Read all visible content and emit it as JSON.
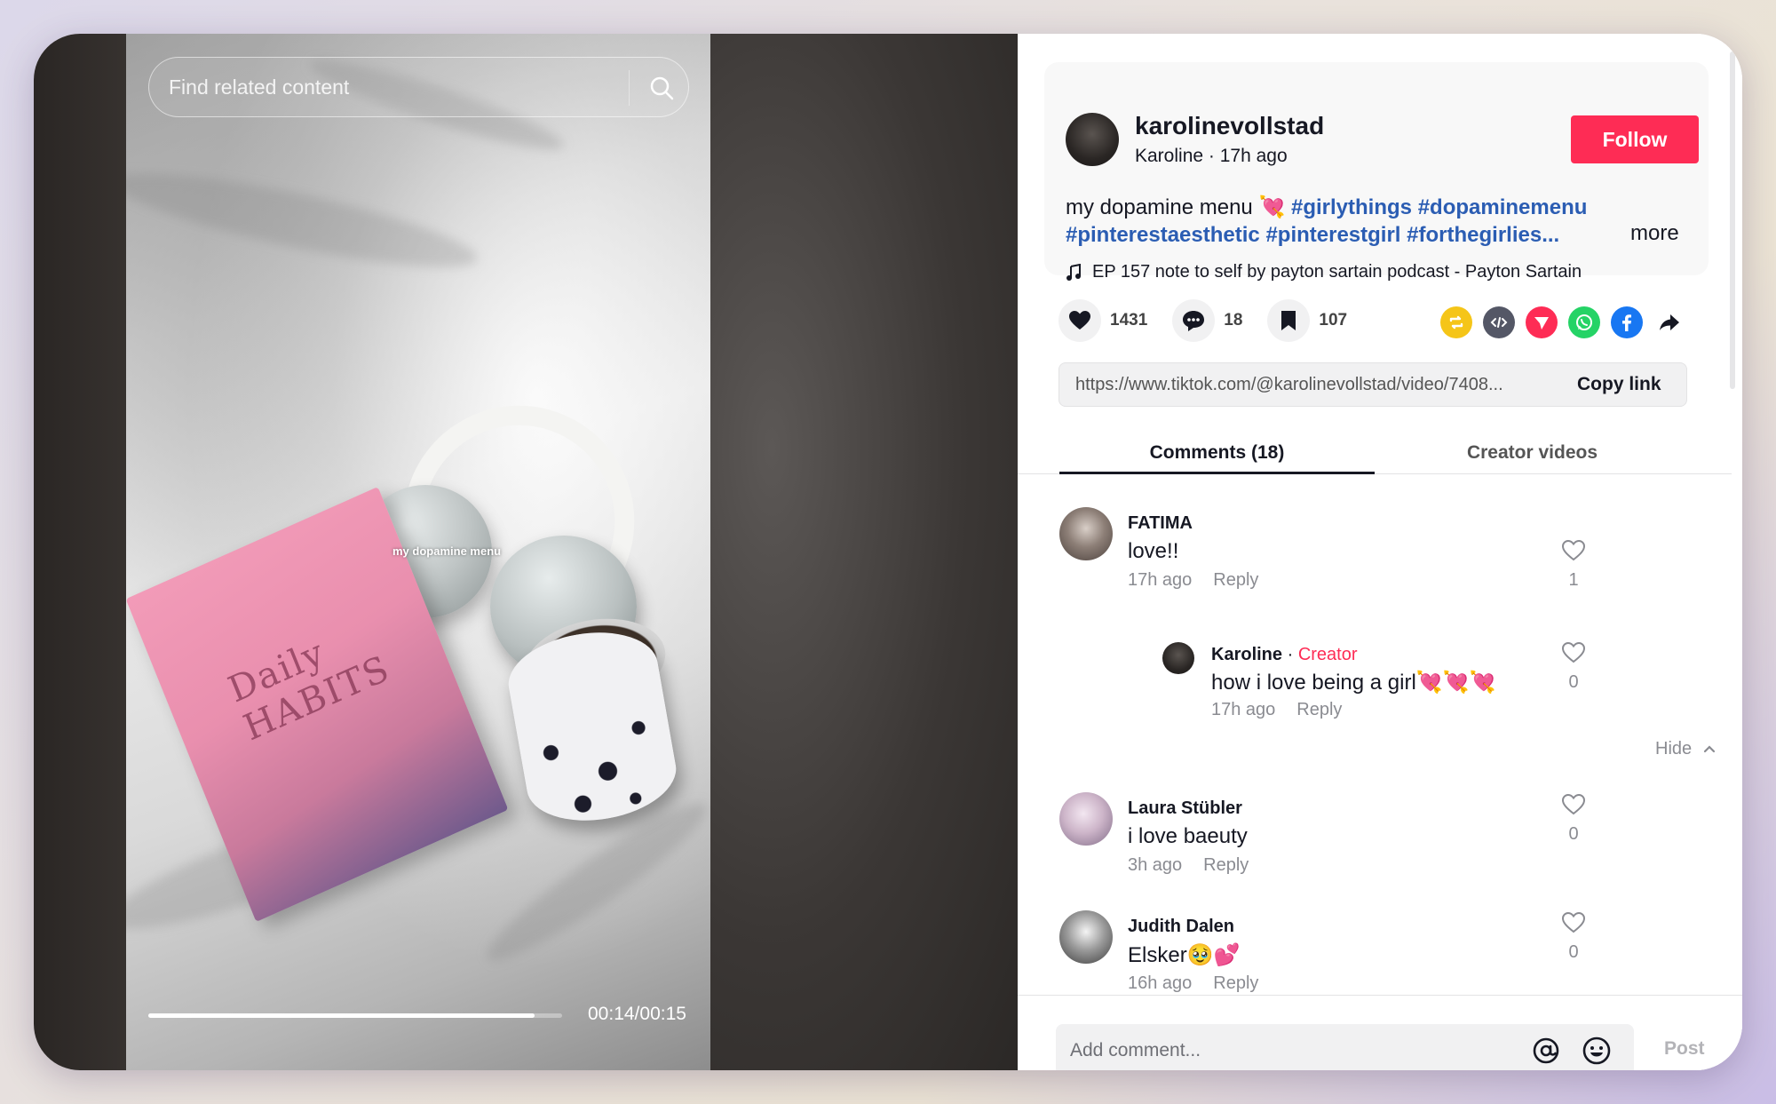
{
  "search": {
    "placeholder": "Find related content"
  },
  "video": {
    "overlay_text": "my dopamine menu",
    "book_title": "Daily HABITS",
    "current_time": "00:14/00:15",
    "progress": 0.933
  },
  "author": {
    "username": "karolinevollstad",
    "display_name": "Karoline",
    "posted": "17h ago",
    "meta_sep": " · ",
    "follow_label": "Follow"
  },
  "post": {
    "caption_text": "my dopamine menu 💘 ",
    "tags": [
      "#girlythings",
      "#dopaminemenu",
      "#pinterestaesthetic",
      "#pinterestgirl",
      "#forthegirlies..."
    ],
    "more_label": "more",
    "music": "EP 157 note to self by payton sartain podcast - Payton Sartain"
  },
  "stats": {
    "likes": "1431",
    "comments": "18",
    "saves": "107"
  },
  "share": {
    "url": "https://www.tiktok.com/@karolinevollstad/video/7408...",
    "copy_label": "Copy link",
    "colors": {
      "repost": "#f5c518",
      "embed": "#545766",
      "direct": "#fe2c55",
      "whatsapp": "#25d366",
      "facebook": "#1877f2"
    }
  },
  "tabs": {
    "comments_label": "Comments (18)",
    "creator_label": "Creator videos"
  },
  "comments": [
    {
      "name": "FATIMA",
      "text": "love!!",
      "time": "17h ago",
      "reply": "Reply",
      "likes": "1"
    },
    {
      "name": "Karoline",
      "name_sep": " · ",
      "badge": "Creator",
      "text": "how i love being a girl💘💘💘",
      "time": "17h ago",
      "reply": "Reply",
      "likes": "0"
    },
    {
      "name": "Laura Stübler",
      "text": "i love baeuty",
      "time": "3h ago",
      "reply": "Reply",
      "likes": "0"
    },
    {
      "name": "Judith Dalen",
      "text": "Elsker🥹💕",
      "time": "16h ago",
      "reply": "Reply",
      "likes": "0"
    }
  ],
  "hide_label": "Hide",
  "composer": {
    "placeholder": "Add comment...",
    "post_label": "Post"
  },
  "colors": {
    "accent": "#fe2c55",
    "hashtag": "#2b5db3"
  }
}
